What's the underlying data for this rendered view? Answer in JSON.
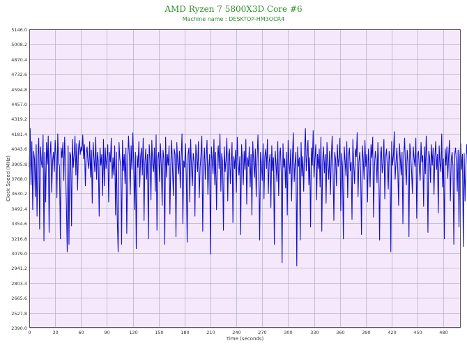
{
  "chart_data": {
    "type": "line",
    "title": "AMD Ryzen 7 5800X3D Core #6",
    "subtitle": "Machine name : DESKTOP-HM3OCR4",
    "xlabel": "Time (seconds)",
    "ylabel": "Clock Speed (MHz)",
    "xlim": [
      0,
      500
    ],
    "ylim": [
      2390.0,
      5146.0
    ],
    "x_ticks": [
      "0",
      "30",
      "60",
      "90",
      "120",
      "150",
      "180",
      "210",
      "240",
      "270",
      "300",
      "330",
      "360",
      "390",
      "420",
      "450",
      "480"
    ],
    "y_ticks": [
      "2390.0",
      "2527.8",
      "2665.6",
      "2803.4",
      "2941.2",
      "3079.0",
      "3216.8",
      "3354.6",
      "3492.4",
      "3630.2",
      "3768.0",
      "3905.8",
      "4043.6",
      "4181.4",
      "4319.2",
      "4457.0",
      "4594.8",
      "4732.6",
      "4870.4",
      "5008.2",
      "5146.0"
    ],
    "grid": true,
    "colors": {
      "line": "#1010cc",
      "plot_bg": "#f5e8fb",
      "grid": "#b4b4c8",
      "title": "#2e8b2e"
    },
    "series": [
      {
        "sample_interval_s": 1,
        "baseline": 4000,
        "values": [
          3870,
          4230,
          3710,
          4110,
          3480,
          4020,
          3950,
          3600,
          4080,
          3420,
          3980,
          4140,
          3300,
          4060,
          3920,
          3870,
          4170,
          3190,
          4010,
          3550,
          4100,
          3900,
          4160,
          3270,
          3980,
          4110,
          3640,
          3930,
          4010,
          3830,
          4120,
          3970,
          3590,
          4180,
          3920,
          3880,
          3210,
          4050,
          3960,
          4100,
          3750,
          4150,
          3880,
          3520,
          3090,
          4070,
          3160,
          4010,
          3980,
          3330,
          4130,
          3870,
          3990,
          4160,
          3800,
          4090,
          3660,
          4040,
          4120,
          3990,
          4060,
          4020,
          4170,
          3950,
          4080,
          3700,
          4010,
          4060,
          3920,
          3860,
          4110,
          3780,
          4030,
          3540,
          4100,
          3960,
          3830,
          4150,
          3760,
          4010,
          3930,
          3420,
          4050,
          3890,
          3990,
          3610,
          4130,
          3700,
          4050,
          3860,
          3970,
          4080,
          3550,
          4010,
          3920,
          4140,
          3770,
          3960,
          3800,
          4070,
          3430,
          4010,
          3390,
          3090,
          4100,
          3950,
          3880,
          3160,
          4120,
          3840,
          3990,
          3720,
          4050,
          3260,
          3910,
          4160,
          3980,
          3620,
          4070,
          3850,
          4190,
          3930,
          3480,
          4010,
          3120,
          3980,
          3870,
          4110,
          3690,
          3960,
          4050,
          3800,
          4140,
          3380,
          3910,
          4040,
          3760,
          3990,
          3210,
          4080,
          3950,
          3570,
          4120,
          3900,
          3830,
          4050,
          3650,
          4170,
          3290,
          3960,
          4010,
          3740,
          4090,
          3880,
          3520,
          4030,
          3950,
          3160,
          4150,
          3780,
          3990,
          3890,
          4070,
          3440,
          3900,
          4120,
          3860,
          3610,
          4040,
          3990,
          3230,
          4100,
          3910,
          3810,
          4020,
          3680,
          3960,
          4180,
          3350,
          3930,
          3870,
          4090,
          3770,
          3180,
          3990,
          4050,
          3550,
          4130,
          3870,
          3700,
          4000,
          3930,
          3420,
          4080,
          3960,
          3830,
          4110,
          3590,
          3870,
          3990,
          4160,
          3280,
          3900,
          4050,
          3760,
          3960,
          4120,
          3620,
          3870,
          3990,
          3070,
          4060,
          3940,
          3810,
          4130,
          3710,
          4010,
          3480,
          3950,
          4070,
          3860,
          4180,
          3650,
          4000,
          3920,
          3290,
          4060,
          3830,
          3940,
          4140,
          3560,
          3980,
          4040,
          3720,
          3910,
          4100,
          3360,
          3970,
          3860,
          4030,
          3640,
          4150,
          3910,
          3800,
          3970,
          3250,
          4080,
          3940,
          3710,
          4020,
          3850,
          4130,
          3530,
          3960,
          3880,
          4060,
          3690,
          3990,
          3430,
          4110,
          3920,
          3780,
          4040,
          3600,
          3940,
          4170,
          3830,
          3200,
          4010,
          3900,
          3750,
          4090,
          3580,
          3970,
          4040,
          3860,
          4130,
          3630,
          3920,
          3990,
          3500,
          4070,
          3840,
          3960,
          3160,
          4020,
          3900,
          3740,
          4110,
          3610,
          3980,
          4050,
          3830,
          2990,
          4090,
          3870,
          3950,
          3680,
          4010,
          3430,
          4120,
          3910,
          3810,
          4040,
          3560,
          3970,
          4190,
          3740,
          3910,
          4010,
          2960,
          4060,
          3880,
          3960,
          3200,
          4100,
          3790,
          3970,
          3650,
          4030,
          4230,
          3840,
          3990,
          4120,
          3710,
          3960,
          3320,
          4050,
          3890,
          4210,
          3780,
          3950,
          4080,
          3570,
          3990,
          3860,
          4040,
          3690,
          4150,
          3280,
          3930,
          4060,
          3820,
          3990,
          3540,
          4100,
          3900,
          3760,
          4020,
          3620,
          3960,
          4160,
          3850,
          3380,
          4010,
          3940,
          3700,
          4080,
          3880,
          3960,
          4140,
          3470,
          4000,
          3870,
          3210,
          4060,
          3930,
          3790,
          4110,
          3590,
          3980,
          4050,
          3840,
          3920,
          3390,
          4130,
          3890,
          3720,
          4040,
          3970,
          4190,
          3600,
          3920,
          4010,
          3830,
          3250,
          4070,
          3950,
          3760,
          4120,
          3880,
          3990,
          3550,
          4040,
          3900,
          3690,
          4080,
          3960,
          4150,
          3410,
          3870,
          4020,
          3940,
          3730,
          4100,
          3860,
          3200,
          3990,
          4060,
          3820,
          3910,
          4130,
          3580,
          3970,
          4040,
          3870,
          3670,
          4020,
          3940,
          3090,
          4110,
          3890,
          3980,
          4200,
          3760,
          3920,
          4050,
          3860,
          3520,
          4090,
          3950,
          3800,
          4010,
          3350,
          3980,
          4140,
          3880,
          3710,
          4030,
          3920,
          3230,
          4090,
          3990,
          3840,
          3630,
          4060,
          3950,
          3880,
          4140,
          3400,
          3990,
          4020,
          3870,
          3750,
          4100,
          3920,
          3980,
          3510,
          4060,
          3810,
          4160,
          3930,
          3270,
          4020,
          3960,
          3730,
          4080,
          3890,
          4050,
          3620,
          3960,
          4110,
          3850,
          3990,
          3450,
          4070,
          3910,
          3830,
          4180,
          3690,
          3950,
          3210,
          4040,
          3890,
          4060,
          3770,
          3980,
          4120,
          3560,
          3940,
          4010,
          3880,
          3160,
          3990,
          4050,
          3920,
          3650,
          4030,
          3320,
          3970,
          4090,
          3850,
          3990,
          3140,
          4000,
          3560,
          3890,
          4080,
          3960,
          3990,
          3460,
          3840,
          4010,
          3180,
          3910,
          4060,
          3980
        ]
      }
    ]
  }
}
